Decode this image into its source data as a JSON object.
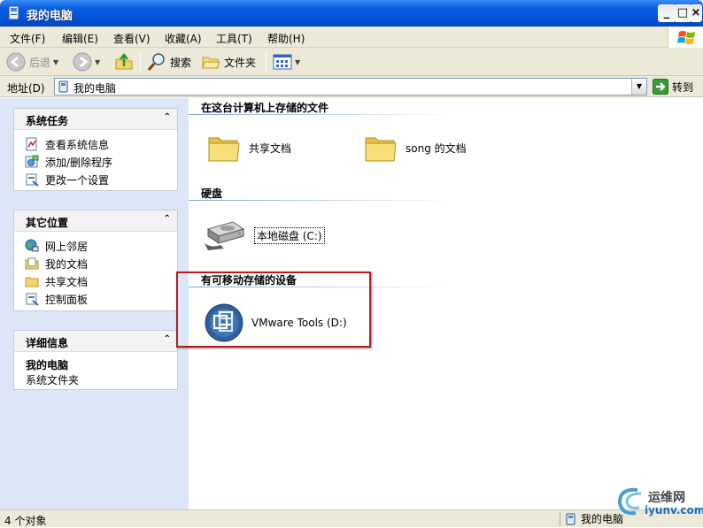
{
  "window": {
    "title": "我的电脑"
  },
  "menu": [
    "文件(F)",
    "编辑(E)",
    "查看(V)",
    "收藏(A)",
    "工具(T)",
    "帮助(H)"
  ],
  "toolbar": {
    "back": "后退",
    "search": "搜索",
    "folders": "文件夹"
  },
  "address": {
    "label": "地址(D)",
    "value": "我的电脑",
    "go": "转到"
  },
  "left": {
    "system_tasks": {
      "title": "系统任务",
      "items": [
        "查看系统信息",
        "添加/删除程序",
        "更改一个设置"
      ]
    },
    "other_places": {
      "title": "其它位置",
      "items": [
        "网上邻居",
        "我的文档",
        "共享文档",
        "控制面板"
      ]
    },
    "details": {
      "title": "详细信息",
      "name": "我的电脑",
      "type": "系统文件夹"
    }
  },
  "content": {
    "stored_files": {
      "title": "在这台计算机上存储的文件",
      "items": [
        "共享文档",
        "song 的文档"
      ]
    },
    "hard_disks": {
      "title": "硬盘",
      "items": [
        "本地磁盘 (C:)"
      ]
    },
    "removable": {
      "title": "有可移动存储的设备",
      "items": [
        "VMware Tools (D:)"
      ]
    }
  },
  "status": {
    "left": "4 个对象",
    "right": "我的电脑"
  },
  "watermark": {
    "cn": "运维网",
    "en": "iyunv.com"
  }
}
